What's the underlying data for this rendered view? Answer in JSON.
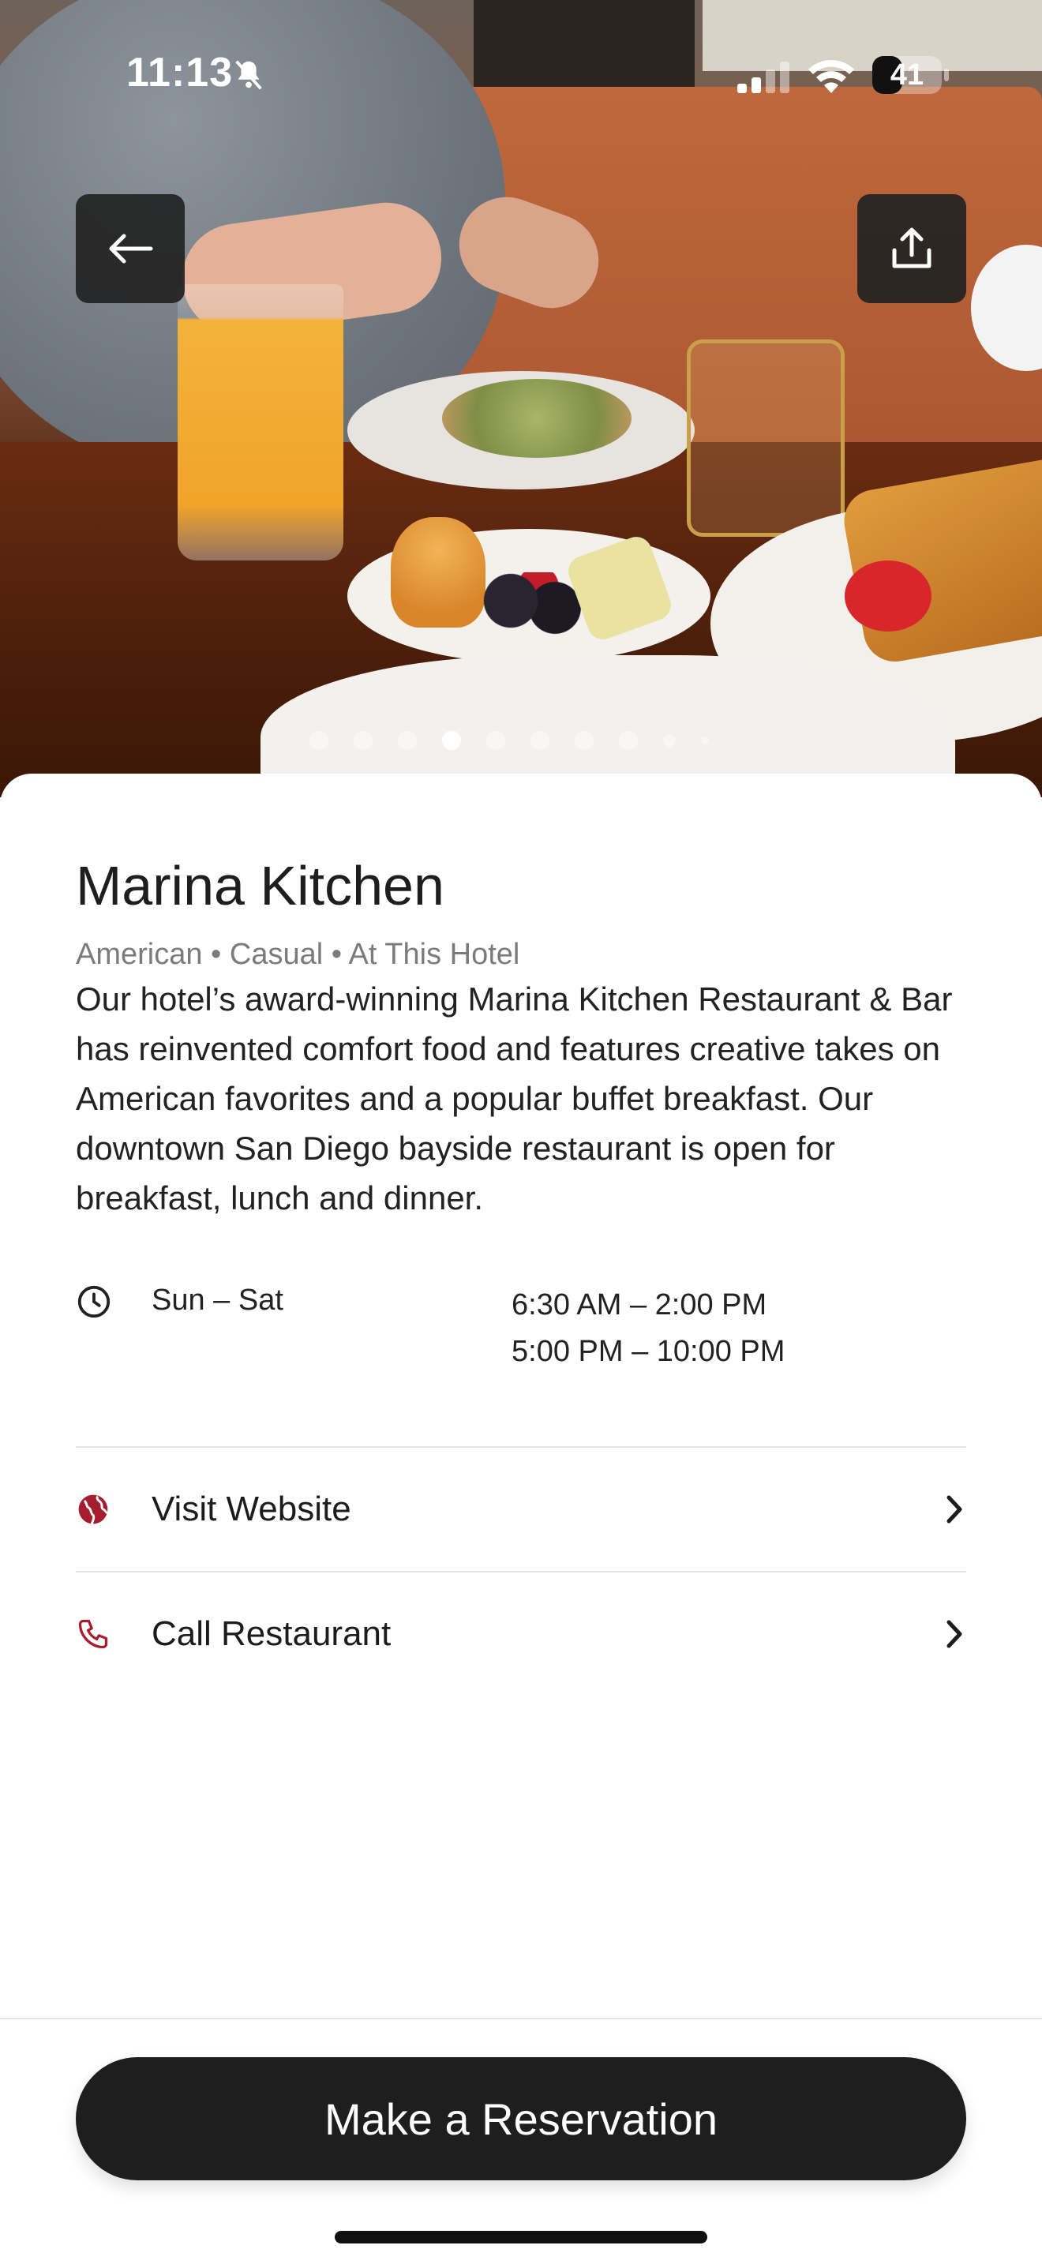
{
  "status_bar": {
    "time": "11:13",
    "battery": "41"
  },
  "hero": {
    "back_icon": "arrow-left-icon",
    "share_icon": "share-icon",
    "carousel": {
      "total": 10,
      "active_index": 3
    }
  },
  "restaurant": {
    "name": "Marina Kitchen",
    "tags": "American • Casual • At This Hotel",
    "description": "Our hotel’s award-winning Marina Kitchen Restaurant & Bar has reinvented comfort food and features creative takes on American favorites and a popular buffet breakfast. Our downtown San Diego bayside restaurant is open for breakfast, lunch and dinner.",
    "hours": {
      "days": "Sun – Sat",
      "times": [
        "6:30 AM – 2:00 PM",
        "5:00 PM – 10:00 PM"
      ]
    }
  },
  "links": {
    "website": "Visit Website",
    "call": "Call Restaurant"
  },
  "cta": {
    "label": "Make a Reservation"
  },
  "colors": {
    "accent": "#a51d2e",
    "button_dark": "#1e1e1e"
  }
}
